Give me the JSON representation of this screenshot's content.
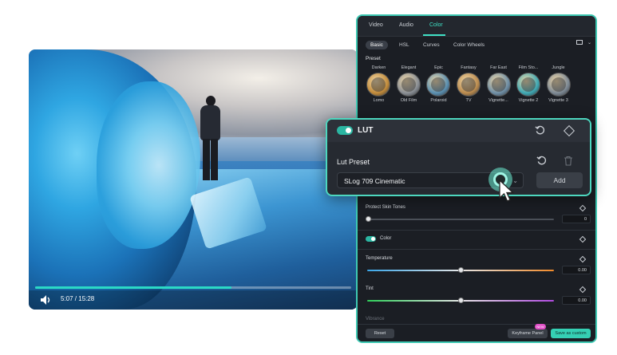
{
  "video": {
    "timecode": "5:07 / 15:28",
    "progress": 0.62
  },
  "panel": {
    "tabs": [
      "Video",
      "Audio",
      "Color"
    ],
    "active_tab": "Color",
    "subtabs": [
      "Basic",
      "HSL",
      "Curves",
      "Color Wheels"
    ],
    "active_subtab": "Basic",
    "preset_label": "Preset",
    "presets_row1": [
      "Darken",
      "Elegant",
      "Epic",
      "Fantasy",
      "Far East",
      "Film Sto...",
      "Jungle"
    ],
    "presets_row2": [
      "Lomo",
      "Old Film",
      "Polaroid",
      "TV",
      "Vignette...",
      "Vignette 2",
      "Vignette 3"
    ],
    "preset_colors": [
      "#c08a3a",
      "#8a8f95",
      "#5a8fb0",
      "#b98a4e",
      "#6f8fa6",
      "#3fa8b3",
      "#7e8a95"
    ],
    "protect_skin_label": "Protect Skin Tones",
    "protect_skin_value": "0",
    "color_section_label": "Color",
    "temperature_label": "Temperature",
    "temperature_value": "0.00",
    "tint_label": "Tint",
    "tint_value": "0.00",
    "vibrance_label": "Vibrance",
    "reset_label": "Reset",
    "keyframe_label": "Keyframe Panel",
    "keyframe_badge": "NEW",
    "save_label": "Save as custom"
  },
  "lut": {
    "title": "LUT",
    "enabled": true,
    "preset_label": "Lut Preset",
    "selected": "SLog 709 Cinematic",
    "add_label": "Add"
  },
  "colors": {
    "accent": "#3fe0c5",
    "panel_bg": "#1b1e24"
  }
}
